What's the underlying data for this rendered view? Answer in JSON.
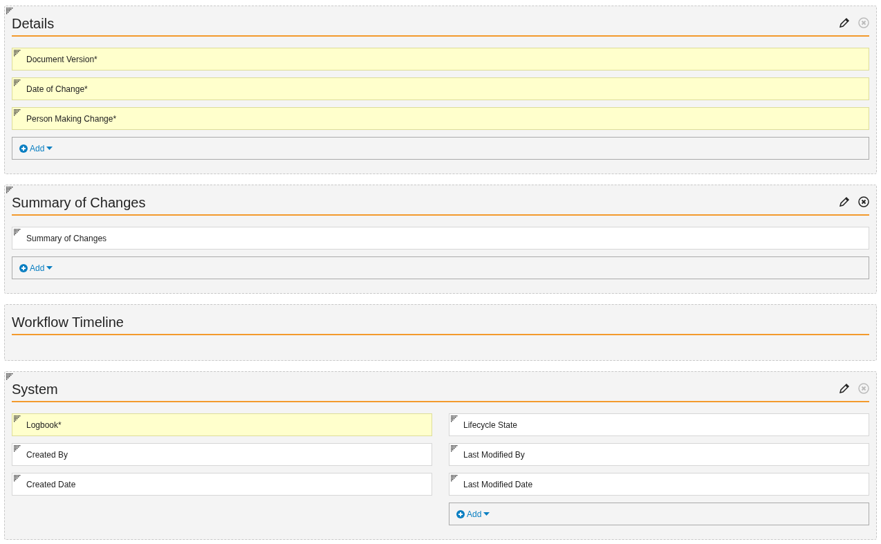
{
  "sections": [
    {
      "title": "Details",
      "draggable": true,
      "actions": true,
      "remove_disabled": true,
      "columns": [
        {
          "fields": [
            {
              "label": "Document Version*",
              "required": true
            },
            {
              "label": "Date of Change*",
              "required": true
            },
            {
              "label": "Person Making Change*",
              "required": true
            }
          ],
          "add": "Add"
        }
      ]
    },
    {
      "title": "Summary of Changes",
      "draggable": true,
      "actions": true,
      "remove_disabled": false,
      "columns": [
        {
          "fields": [
            {
              "label": "Summary of Changes",
              "required": false
            }
          ],
          "add": "Add"
        }
      ]
    },
    {
      "title": "Workflow Timeline",
      "draggable": false,
      "actions": false
    },
    {
      "title": "System",
      "draggable": true,
      "actions": true,
      "remove_disabled": true,
      "columns": [
        {
          "fields": [
            {
              "label": "Logbook*",
              "required": true
            },
            {
              "label": "Created By",
              "required": false
            },
            {
              "label": "Created Date",
              "required": false
            }
          ]
        },
        {
          "fields": [
            {
              "label": "Lifecycle State",
              "required": false
            },
            {
              "label": "Last Modified By",
              "required": false
            },
            {
              "label": "Last Modified Date",
              "required": false
            }
          ],
          "add": "Add"
        }
      ]
    }
  ]
}
